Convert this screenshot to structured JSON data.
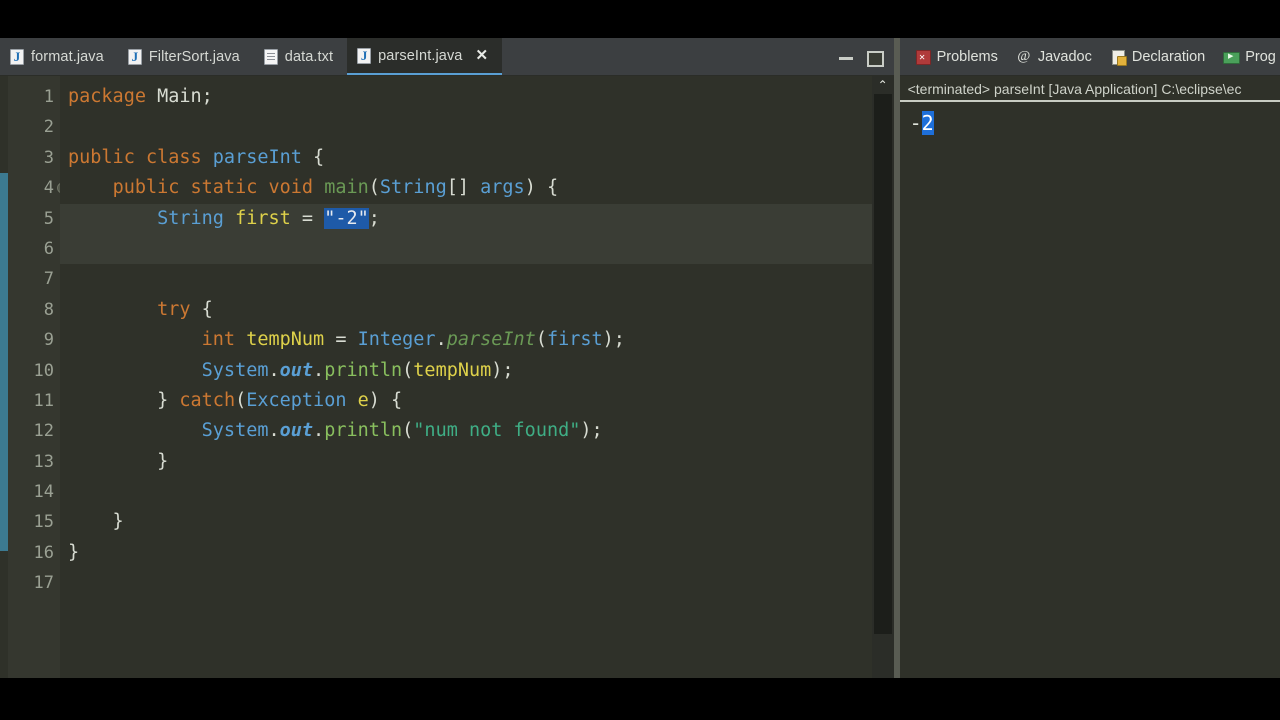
{
  "editor": {
    "tabs": [
      {
        "label": "format.java",
        "icon": "java-file-icon",
        "active": false,
        "closable": false
      },
      {
        "label": "FilterSort.java",
        "icon": "java-file-icon",
        "active": false,
        "closable": false
      },
      {
        "label": "data.txt",
        "icon": "text-file-icon",
        "active": false,
        "closable": false
      },
      {
        "label": "parseInt.java",
        "icon": "java-file-icon",
        "active": true,
        "closable": true
      }
    ],
    "close_glyph": "✕",
    "window_buttons": [
      {
        "name": "minimize-button",
        "label": "Minimize"
      },
      {
        "name": "maximize-button",
        "label": "Maximize"
      }
    ],
    "scroll_up_glyph": "⌃",
    "line_numbers": [
      "1",
      "2",
      "3",
      "4",
      "5",
      "6",
      "7",
      "8",
      "9",
      "10",
      "11",
      "12",
      "13",
      "14",
      "15",
      "16",
      "17"
    ],
    "fold_line": 4,
    "current_line": 5,
    "change_marker_lines": [
      4,
      15
    ],
    "code_lines": [
      {
        "n": 1,
        "text": "package Main;"
      },
      {
        "n": 2,
        "text": ""
      },
      {
        "n": 3,
        "text": "public class parseInt {"
      },
      {
        "n": 4,
        "text": "    public static void main(String[] args) {"
      },
      {
        "n": 5,
        "text": "        String first = \"-2\";"
      },
      {
        "n": 6,
        "text": ""
      },
      {
        "n": 7,
        "text": ""
      },
      {
        "n": 8,
        "text": "        try {"
      },
      {
        "n": 9,
        "text": "            int tempNum = Integer.parseInt(first);"
      },
      {
        "n": 10,
        "text": "            System.out.println(tempNum);"
      },
      {
        "n": 11,
        "text": "        } catch(Exception e) {"
      },
      {
        "n": 12,
        "text": "            System.out.println(\"num not found\");"
      },
      {
        "n": 13,
        "text": "        }"
      },
      {
        "n": 14,
        "text": ""
      },
      {
        "n": 15,
        "text": "    }"
      },
      {
        "n": 16,
        "text": "}"
      },
      {
        "n": 17,
        "text": ""
      }
    ]
  },
  "console": {
    "view_tabs": [
      {
        "label": "Problems",
        "icon": "problems-icon"
      },
      {
        "label": "Javadoc",
        "icon": "javadoc-icon"
      },
      {
        "label": "Declaration",
        "icon": "declaration-icon"
      },
      {
        "label": "Prog",
        "icon": "progress-icon"
      }
    ],
    "launch_header": "<terminated> parseInt [Java Application] C:\\eclipse\\ec",
    "output_prefix": "-",
    "output_selected": "2"
  },
  "colors": {
    "background": "#2f3129",
    "tab_bar": "#3c3f41",
    "active_tab": "#2b2d2a",
    "accent": "#5a9fd4",
    "keyword": "#cc7832",
    "type": "#5a9fd4",
    "method": "#89bf5e",
    "variable": "#ded14a",
    "string": "#3fae85",
    "selection": "#1e5aa8",
    "change_marker": "#3c7a91",
    "console_selection": "#1e6fd9"
  }
}
